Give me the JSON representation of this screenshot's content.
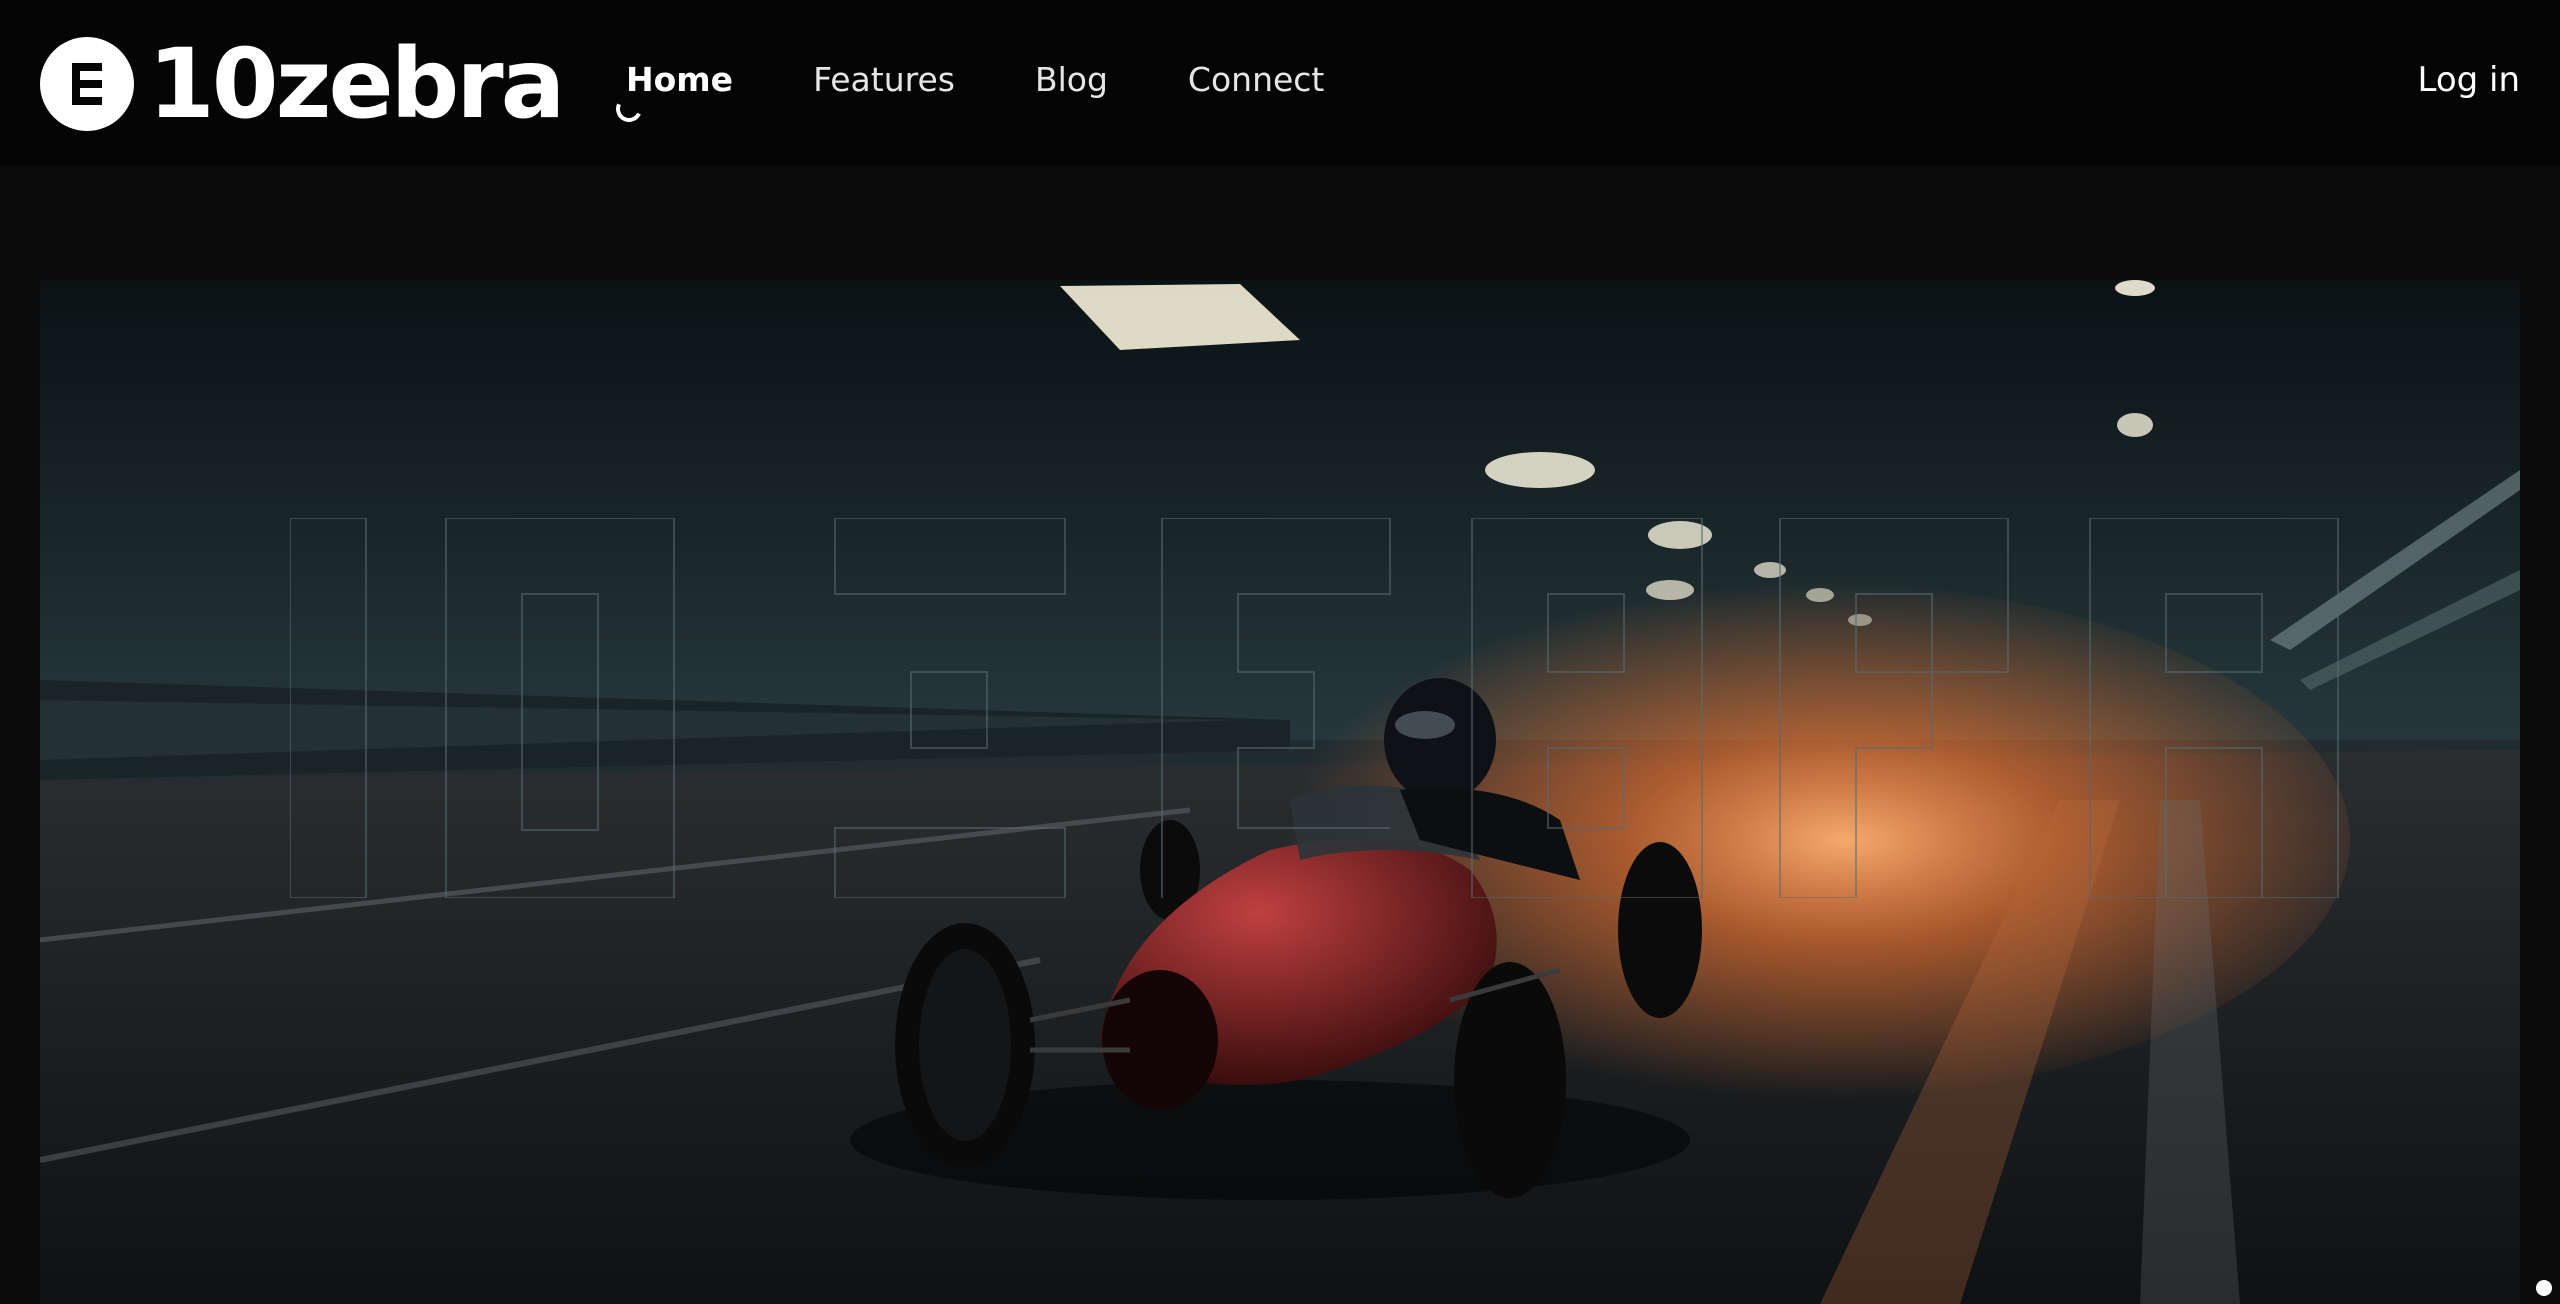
{
  "brand": {
    "name": "10zebra",
    "logo_icon": "zebra-e-logo-icon"
  },
  "nav": {
    "items": [
      {
        "label": "Home",
        "active": true
      },
      {
        "label": "Features",
        "active": false
      },
      {
        "label": "Blog",
        "active": false
      },
      {
        "label": "Connect",
        "active": false
      }
    ]
  },
  "auth": {
    "login_label": "Log in"
  },
  "hero": {
    "image": "night-race-car-in-tunnel",
    "background_word": "10zebra",
    "colors": {
      "tunnel": "#1b2a2e",
      "glow": "#ff8a3d",
      "car": "#7a1a1a"
    }
  },
  "colors": {
    "header_bg": "#050505",
    "page_bg": "#0b0b0b",
    "text": "#ffffff"
  }
}
